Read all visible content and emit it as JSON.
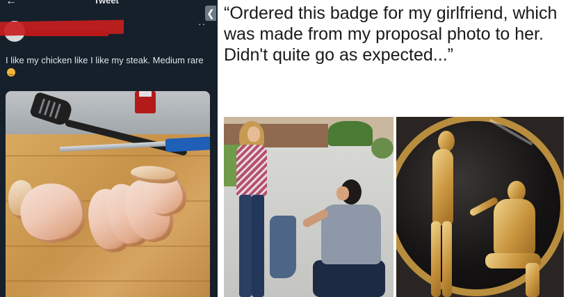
{
  "tweet_panel": {
    "header_title": "Tweet",
    "back_icon": "arrow-left-icon",
    "more_icon": "more-dots-icon",
    "body_text": "I like my chicken like I like my steak. Medium rare",
    "emoji_icon": "grinning-face-emoji-icon",
    "photo_description_icon": "photo-chicken-board"
  },
  "right_panel": {
    "collapse_icon": "chevron-left-icon",
    "caption": "“Ordered this badge for my girlfriend, which was made from my proposal photo to her. Didn't quite go as expected...”"
  },
  "colors": {
    "tweet_bg": "#15202b",
    "redaction": "#c81e1e",
    "badge_gold": "#c9953f"
  }
}
